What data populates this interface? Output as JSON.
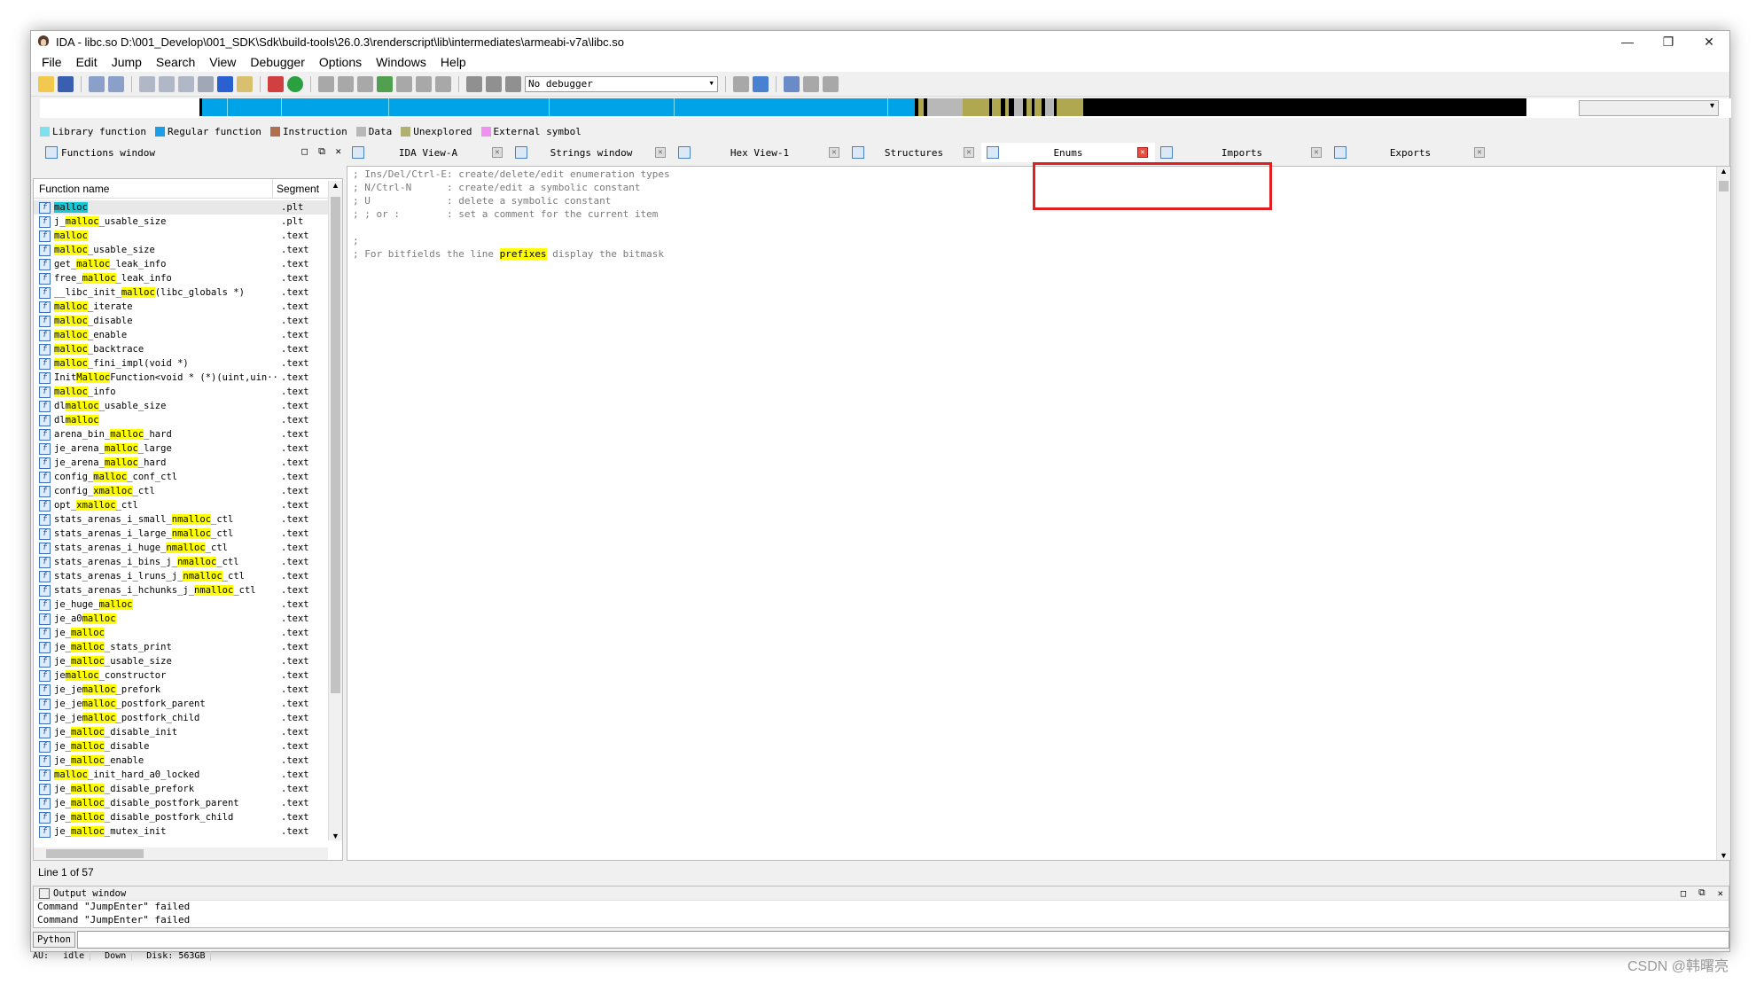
{
  "window": {
    "title": "IDA - libc.so D:\\001_Develop\\001_SDK\\Sdk\\build-tools\\26.0.3\\renderscript\\lib\\intermediates\\armeabi-v7a\\libc.so",
    "minimize": "—",
    "restore": "❐",
    "close": "✕"
  },
  "menu": [
    "File",
    "Edit",
    "Jump",
    "Search",
    "View",
    "Debugger",
    "Options",
    "Windows",
    "Help"
  ],
  "toolbar": {
    "debugger_select": "No debugger"
  },
  "legend": [
    {
      "label": "Library function",
      "color": "#7fe0f0"
    },
    {
      "label": "Regular function",
      "color": "#1a9ee6"
    },
    {
      "label": "Instruction",
      "color": "#b07050"
    },
    {
      "label": "Data",
      "color": "#b8b8b8"
    },
    {
      "label": "Unexplored",
      "color": "#b0b070"
    },
    {
      "label": "External symbol",
      "color": "#f090f0"
    }
  ],
  "navbar": {
    "colors": {
      "library": "#7fe0f0",
      "regular": "#00a2e8",
      "data": "#b8b8b8",
      "unexplored": "#b0a850",
      "black": "#000000"
    }
  },
  "functions_tab": {
    "label": "Functions window"
  },
  "tabs": [
    {
      "label": "IDA View-A",
      "icon": "ida-view-icon"
    },
    {
      "label": "Strings window",
      "icon": "strings-icon"
    },
    {
      "label": "Hex View-1",
      "icon": "hex-view-icon"
    },
    {
      "label": "Structures",
      "icon": "structures-icon"
    },
    {
      "label": "Enums",
      "icon": "enums-icon",
      "active": true
    },
    {
      "label": "Imports",
      "icon": "imports-icon"
    },
    {
      "label": "Exports",
      "icon": "exports-icon"
    }
  ],
  "functions": {
    "columns": [
      "Function name",
      "Segment"
    ],
    "status": "Line 1 of 57",
    "rows": [
      {
        "pre": "",
        "hl": "malloc",
        "post": "",
        "seg": ".plt",
        "selected": true
      },
      {
        "pre": "j_",
        "hl": "malloc",
        "post": "_usable_size",
        "seg": ".plt"
      },
      {
        "pre": "",
        "hl": "malloc",
        "post": "",
        "seg": ".text"
      },
      {
        "pre": "",
        "hl": "malloc",
        "post": "_usable_size",
        "seg": ".text"
      },
      {
        "pre": "get_",
        "hl": "malloc",
        "post": "_leak_info",
        "seg": ".text"
      },
      {
        "pre": "free_",
        "hl": "malloc",
        "post": "_leak_info",
        "seg": ".text"
      },
      {
        "pre": "__libc_init_",
        "hl": "malloc",
        "post": "(libc_globals *)",
        "seg": ".text"
      },
      {
        "pre": "",
        "hl": "malloc",
        "post": "_iterate",
        "seg": ".text"
      },
      {
        "pre": "",
        "hl": "malloc",
        "post": "_disable",
        "seg": ".text"
      },
      {
        "pre": "",
        "hl": "malloc",
        "post": "_enable",
        "seg": ".text"
      },
      {
        "pre": "",
        "hl": "malloc",
        "post": "_backtrace",
        "seg": ".text"
      },
      {
        "pre": "",
        "hl": "malloc",
        "post": "_fini_impl(void *)",
        "seg": ".text"
      },
      {
        "pre": "Init",
        "hl": "Malloc",
        "post": "Function<void * (*)(uint,uin···",
        "seg": ".text"
      },
      {
        "pre": "",
        "hl": "malloc",
        "post": "_info",
        "seg": ".text"
      },
      {
        "pre": "dl",
        "hl": "malloc",
        "post": "_usable_size",
        "seg": ".text"
      },
      {
        "pre": "dl",
        "hl": "malloc",
        "post": "",
        "seg": ".text"
      },
      {
        "pre": "arena_bin_",
        "hl": "malloc",
        "post": "_hard",
        "seg": ".text"
      },
      {
        "pre": "je_arena_",
        "hl": "malloc",
        "post": "_large",
        "seg": ".text"
      },
      {
        "pre": "je_arena_",
        "hl": "malloc",
        "post": "_hard",
        "seg": ".text"
      },
      {
        "pre": "config_",
        "hl": "malloc",
        "post": "_conf_ctl",
        "seg": ".text"
      },
      {
        "pre": "config_",
        "hl": "xmalloc",
        "post": "_ctl",
        "seg": ".text"
      },
      {
        "pre": "opt_",
        "hl": "xmalloc",
        "post": "_ctl",
        "seg": ".text"
      },
      {
        "pre": "stats_arenas_i_small_",
        "hl": "nmalloc",
        "post": "_ctl",
        "seg": ".text"
      },
      {
        "pre": "stats_arenas_i_large_",
        "hl": "nmalloc",
        "post": "_ctl",
        "seg": ".text"
      },
      {
        "pre": "stats_arenas_i_huge_",
        "hl": "nmalloc",
        "post": "_ctl",
        "seg": ".text"
      },
      {
        "pre": "stats_arenas_i_bins_j_",
        "hl": "nmalloc",
        "post": "_ctl",
        "seg": ".text"
      },
      {
        "pre": "stats_arenas_i_lruns_j_",
        "hl": "nmalloc",
        "post": "_ctl",
        "seg": ".text"
      },
      {
        "pre": "stats_arenas_i_hchunks_j_",
        "hl": "nmalloc",
        "post": "_ctl",
        "seg": ".text"
      },
      {
        "pre": "je_huge_",
        "hl": "malloc",
        "post": "",
        "seg": ".text"
      },
      {
        "pre": "je_a0",
        "hl": "malloc",
        "post": "",
        "seg": ".text"
      },
      {
        "pre": "je_",
        "hl": "malloc",
        "post": "",
        "seg": ".text"
      },
      {
        "pre": "je_",
        "hl": "malloc",
        "post": "_stats_print",
        "seg": ".text"
      },
      {
        "pre": "je_",
        "hl": "malloc",
        "post": "_usable_size",
        "seg": ".text"
      },
      {
        "pre": "je",
        "hl": "malloc",
        "post": "_constructor",
        "seg": ".text"
      },
      {
        "pre": "je_je",
        "hl": "malloc",
        "post": "_prefork",
        "seg": ".text"
      },
      {
        "pre": "je_je",
        "hl": "malloc",
        "post": "_postfork_parent",
        "seg": ".text"
      },
      {
        "pre": "je_je",
        "hl": "malloc",
        "post": "_postfork_child",
        "seg": ".text"
      },
      {
        "pre": "je_",
        "hl": "malloc",
        "post": "_disable_init",
        "seg": ".text"
      },
      {
        "pre": "je_",
        "hl": "malloc",
        "post": "_disable",
        "seg": ".text"
      },
      {
        "pre": "je_",
        "hl": "malloc",
        "post": "_enable",
        "seg": ".text"
      },
      {
        "pre": "",
        "hl": "malloc",
        "post": "_init_hard_a0_locked",
        "seg": ".text"
      },
      {
        "pre": "je_",
        "hl": "malloc",
        "post": "_disable_prefork",
        "seg": ".text"
      },
      {
        "pre": "je_",
        "hl": "malloc",
        "post": "_disable_postfork_parent",
        "seg": ".text"
      },
      {
        "pre": "je_",
        "hl": "malloc",
        "post": "_disable_postfork_child",
        "seg": ".text"
      },
      {
        "pre": "je_",
        "hl": "malloc",
        "post": "_mutex_init",
        "seg": ".text"
      }
    ]
  },
  "enums_view": {
    "lines": [
      {
        "text": "; Ins/Del/Ctrl-E: create/delete/edit enumeration types"
      },
      {
        "text": "; N/Ctrl-N      : create/edit a symbolic constant"
      },
      {
        "text": "; U             : delete a symbolic constant"
      },
      {
        "text": "; ; or :        : set a comment for the current item"
      },
      {
        "text": ";"
      },
      {
        "text": "; For bitfields the line ",
        "hl": "prefixes",
        "post": " display the bitmask"
      }
    ]
  },
  "output": {
    "title": "Output window",
    "lines": [
      "Command \"JumpEnter\" failed",
      "Command \"JumpEnter\" failed"
    ],
    "python_button": "Python"
  },
  "status": {
    "au": "AU:",
    "state": "idle",
    "direction": "Down",
    "disk": "Disk: 563GB"
  },
  "watermark": "CSDN @韩曙亮"
}
